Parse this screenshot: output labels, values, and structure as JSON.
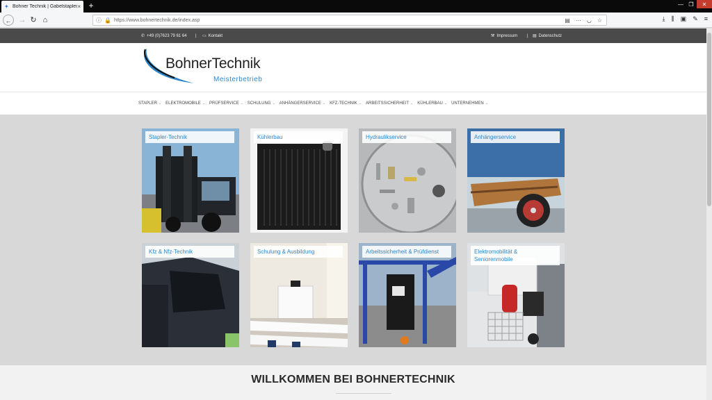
{
  "browser": {
    "tab_title": "Bohner Technik | Gabelstapler",
    "tab_close": "×",
    "new_tab": "+",
    "url": "https://www.bohnertechnik.de/index.asp",
    "win_min": "—",
    "win_max": "❐",
    "win_close": "✕"
  },
  "topbar": {
    "phone": "+49 (0)7623 79 61 64",
    "separator": "|",
    "kontakt": "Kontakt",
    "impressum": "Impressum",
    "datenschutz": "Datenschutz"
  },
  "logo": {
    "name": "BohnerTechnik",
    "subtitle": "Meisterbetrieb"
  },
  "menu": [
    {
      "label": "STAPLER"
    },
    {
      "label": "ELEKTROMOBILE"
    },
    {
      "label": "PRÜFSERVICE"
    },
    {
      "label": "SCHULUNG"
    },
    {
      "label": "ANHÄNGERSERVICE"
    },
    {
      "label": "KFZ-TECHNIK"
    },
    {
      "label": "ARBEITSSICHERHEIT"
    },
    {
      "label": "KÜHLERBAU"
    },
    {
      "label": "UNTERNEHMEN"
    }
  ],
  "tiles": [
    {
      "label": "Stapler-Technik"
    },
    {
      "label": "Kühlerbau"
    },
    {
      "label": "Hydraulikservice"
    },
    {
      "label": "Anhängerservice"
    },
    {
      "label": "Kfz & Nfz-Technik"
    },
    {
      "label": "Schulung & Ausbildung"
    },
    {
      "label": "Arbeitssicherheit & Prüfdienst"
    },
    {
      "label": "Elektromobilität & Seniorenmobile"
    }
  ],
  "welcome": {
    "heading": "WILLKOMMEN BEI BOHNERTECHNIK"
  },
  "colors": {
    "brand_blue": "#2e86c8",
    "topbar_bg": "#4a4a4a"
  }
}
